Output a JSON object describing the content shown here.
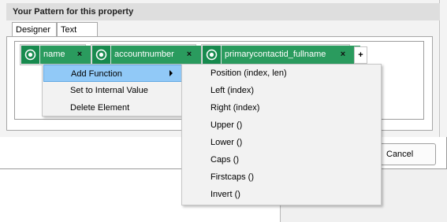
{
  "section": {
    "title": "Your Pattern for this property"
  },
  "tabs": [
    {
      "label": "Designer",
      "selected": true
    },
    {
      "label": "Text",
      "selected": false
    }
  ],
  "tokens": [
    {
      "label": "name",
      "remove": "×"
    },
    {
      "label": "accountnumber",
      "remove": "×"
    },
    {
      "label": "primarycontactid_fullname",
      "remove": "×"
    }
  ],
  "add_token_label": "+",
  "context_menu": {
    "items": [
      {
        "label": "Add Function",
        "highlighted": true,
        "has_submenu": true
      },
      {
        "label": "Set to Internal Value"
      },
      {
        "label": "Delete Element"
      }
    ]
  },
  "submenu": {
    "items": [
      "Position (index, len)",
      "Left (index)",
      "Right (index)",
      "Upper ()",
      "Lower ()",
      "Caps ()",
      "Firstcaps ()",
      "Invert ()"
    ]
  },
  "buttons": {
    "cancel": "Cancel"
  },
  "colors": {
    "token_icon": "#178a4e",
    "token_label": "#2a9b5e",
    "menu_highlight": "#91c9f7"
  }
}
